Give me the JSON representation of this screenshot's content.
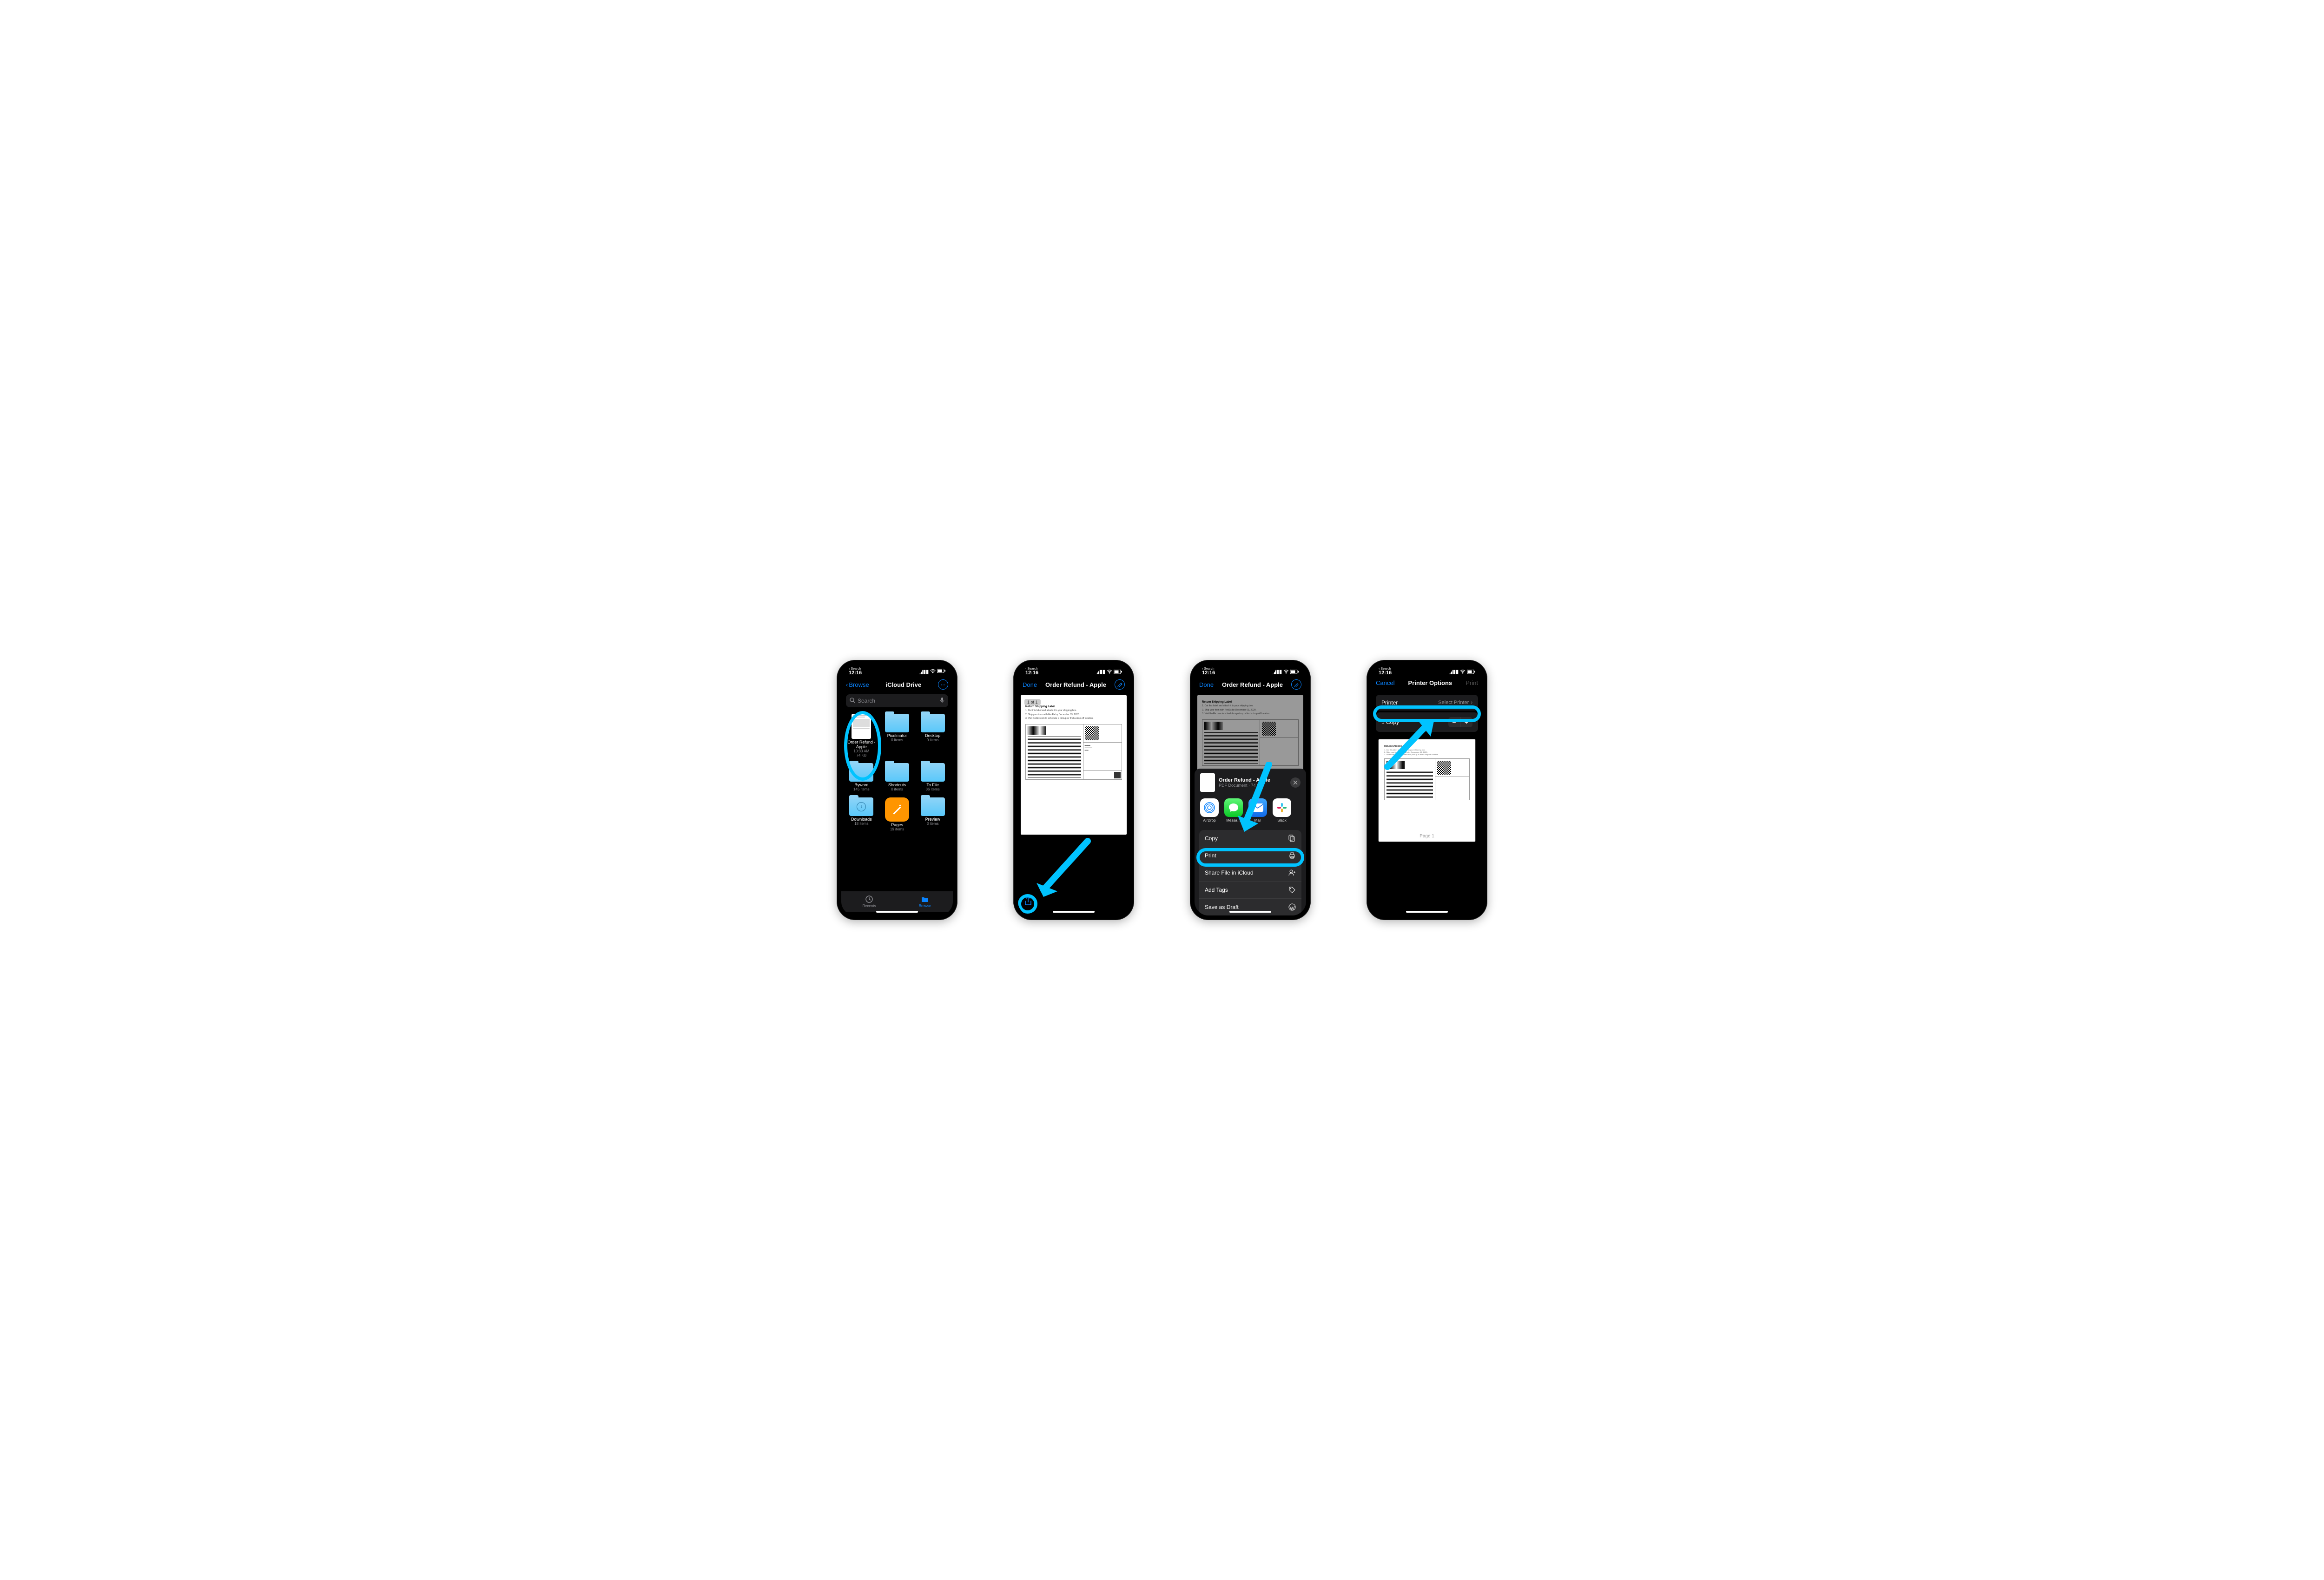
{
  "status": {
    "time": "12:16",
    "back_mini": "Search",
    "loc_icon": "location"
  },
  "colors": {
    "accent": "#0a84ff",
    "highlight": "#00c3ff"
  },
  "screen1": {
    "nav": {
      "back": "Browse",
      "title": "iCloud Drive"
    },
    "search_placeholder": "Search",
    "items": [
      {
        "name": "Order Refund - Apple",
        "line1": "10:33 AM",
        "line2": "74 KB",
        "type": "doc"
      },
      {
        "name": "Pixelmator",
        "line1": "0 items",
        "line2": "",
        "type": "folder"
      },
      {
        "name": "Desktop",
        "line1": "0 items",
        "line2": "",
        "type": "folder"
      },
      {
        "name": "Byword",
        "line1": "145 items",
        "line2": "",
        "type": "folder"
      },
      {
        "name": "Shortcuts",
        "line1": "0 items",
        "line2": "",
        "type": "folder"
      },
      {
        "name": "To File",
        "line1": "36 items",
        "line2": "",
        "type": "folder"
      },
      {
        "name": "Downloads",
        "line1": "18 items",
        "line2": "",
        "type": "folder-dl"
      },
      {
        "name": "Pages",
        "line1": "19 items",
        "line2": "",
        "type": "pages"
      },
      {
        "name": "Preview",
        "line1": "3 items",
        "line2": "",
        "type": "folder"
      }
    ],
    "tabs": {
      "recents": "Recents",
      "browse": "Browse"
    }
  },
  "screen2": {
    "nav": {
      "done": "Done",
      "title": "Order Refund - Apple"
    },
    "page_indicator": "1 of 1",
    "doc": {
      "heading": "Return Shipping Label",
      "steps": [
        "Cut this label and attach it to your shipping box.",
        "Ship your item with FedEx by December 03, 2020.",
        "Visit FedEx.com to schedule a pickup or find a drop-off location."
      ]
    }
  },
  "screen3": {
    "nav": {
      "done": "Done",
      "title": "Order Refund - Apple"
    },
    "sheet": {
      "title": "Order Refund - Apple",
      "subtitle": "PDF Document · 74 KB",
      "apps": [
        "AirDrop",
        "Messa…",
        "Mail",
        "Slack"
      ],
      "actions": [
        "Copy",
        "Print",
        "Share File in iCloud",
        "Add Tags",
        "Save as Draft"
      ]
    }
  },
  "screen4": {
    "nav": {
      "cancel": "Cancel",
      "title": "Printer Options",
      "print": "Print"
    },
    "printer_row": {
      "label": "Printer",
      "value": "Select Printer"
    },
    "copies_row": {
      "label": "1 Copy"
    },
    "preview_page": "Page 1"
  }
}
